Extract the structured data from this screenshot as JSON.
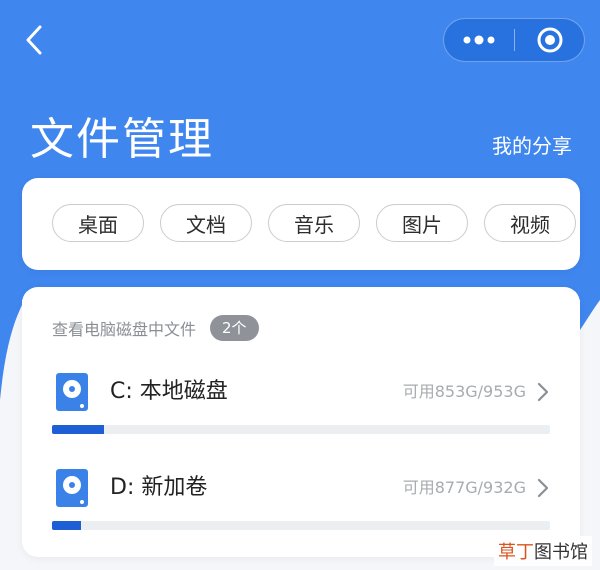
{
  "header": {
    "title": "文件管理",
    "share_link": "我的分享"
  },
  "categories": [
    "桌面",
    "文档",
    "音乐",
    "图片",
    "视频"
  ],
  "disks": {
    "section_title": "查看电脑磁盘中文件",
    "count": "2个",
    "items": [
      {
        "name": "C: 本地磁盘",
        "capacity": "可用853G/953G",
        "used_fraction": 0.105
      },
      {
        "name": "D: 新加卷",
        "capacity": "可用877G/932G",
        "used_fraction": 0.059
      }
    ]
  },
  "watermark": {
    "accent": "草丁",
    "text": "图书馆"
  },
  "colors": {
    "brand_blue": "#3f86ef",
    "progress_fill": "#1f5fd6",
    "disk_icon": "#3b82e8"
  },
  "icons": {
    "back": "chevron-left-icon",
    "more": "more-dots-icon",
    "close": "target-circle-icon",
    "disk": "hard-disk-icon",
    "arrow": "chevron-right-icon"
  }
}
